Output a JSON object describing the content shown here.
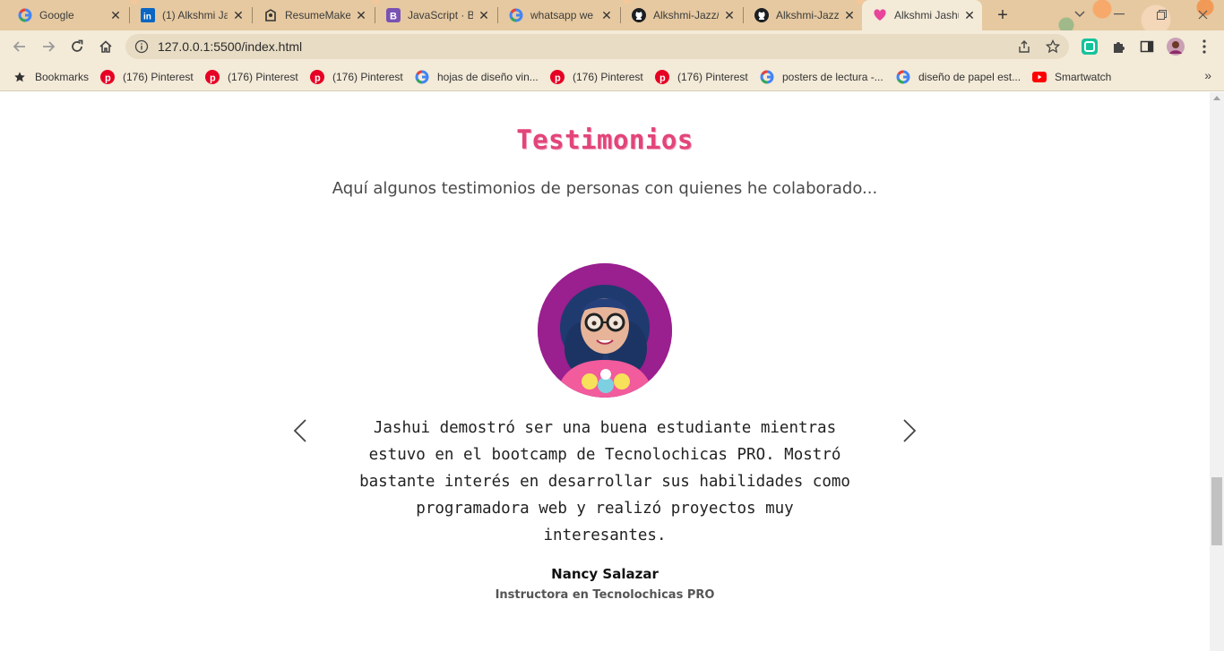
{
  "browser": {
    "tabs": [
      {
        "title": "Google",
        "icon": "google-icon"
      },
      {
        "title": "(1) Alkshmi Ja",
        "icon": "linkedin-icon"
      },
      {
        "title": "ResumeMake",
        "icon": "resumemaker-icon"
      },
      {
        "title": "JavaScript · Bo",
        "icon": "bootstrap-icon"
      },
      {
        "title": "whatsapp we",
        "icon": "google-icon"
      },
      {
        "title": "Alkshmi-Jazz/",
        "icon": "github-icon"
      },
      {
        "title": "Alkshmi-Jazz/",
        "icon": "github-icon"
      },
      {
        "title": "Alkshmi Jashu",
        "icon": "heart-icon"
      }
    ],
    "url": "127.0.0.1:5500/index.html",
    "bookmarks": [
      {
        "label": "Bookmarks",
        "icon": "star-icon"
      },
      {
        "label": "(176) Pinterest",
        "icon": "pinterest-icon"
      },
      {
        "label": "(176) Pinterest",
        "icon": "pinterest-icon"
      },
      {
        "label": "(176) Pinterest",
        "icon": "pinterest-icon"
      },
      {
        "label": "hojas de diseño vin...",
        "icon": "google-icon"
      },
      {
        "label": "(176) Pinterest",
        "icon": "pinterest-icon"
      },
      {
        "label": "(176) Pinterest",
        "icon": "pinterest-icon"
      },
      {
        "label": "posters de lectura -...",
        "icon": "google-icon"
      },
      {
        "label": "diseño de papel est...",
        "icon": "google-icon"
      },
      {
        "label": "Smartwatch",
        "icon": "youtube-icon"
      }
    ],
    "colors": {
      "frame": "#e6c9a0",
      "toolbar": "#f3ead8"
    }
  },
  "testimonials": {
    "title": "Testimonios",
    "subtitle": "Aquí algunos testimonios de personas con quienes he colaborado...",
    "quote": "Jashui demostró ser una buena estudiante mientras estuvo en el bootcamp de Tecnolochicas PRO. Mostró bastante interés en desarrollar sus habilidades como programadora web y realizó proyectos muy interesantes.",
    "author": "Nancy Salazar",
    "role": "Instructora en Tecnolochicas PRO",
    "colors": {
      "title": "#e2457a",
      "avatar_bg": "#9a1f8f"
    }
  }
}
